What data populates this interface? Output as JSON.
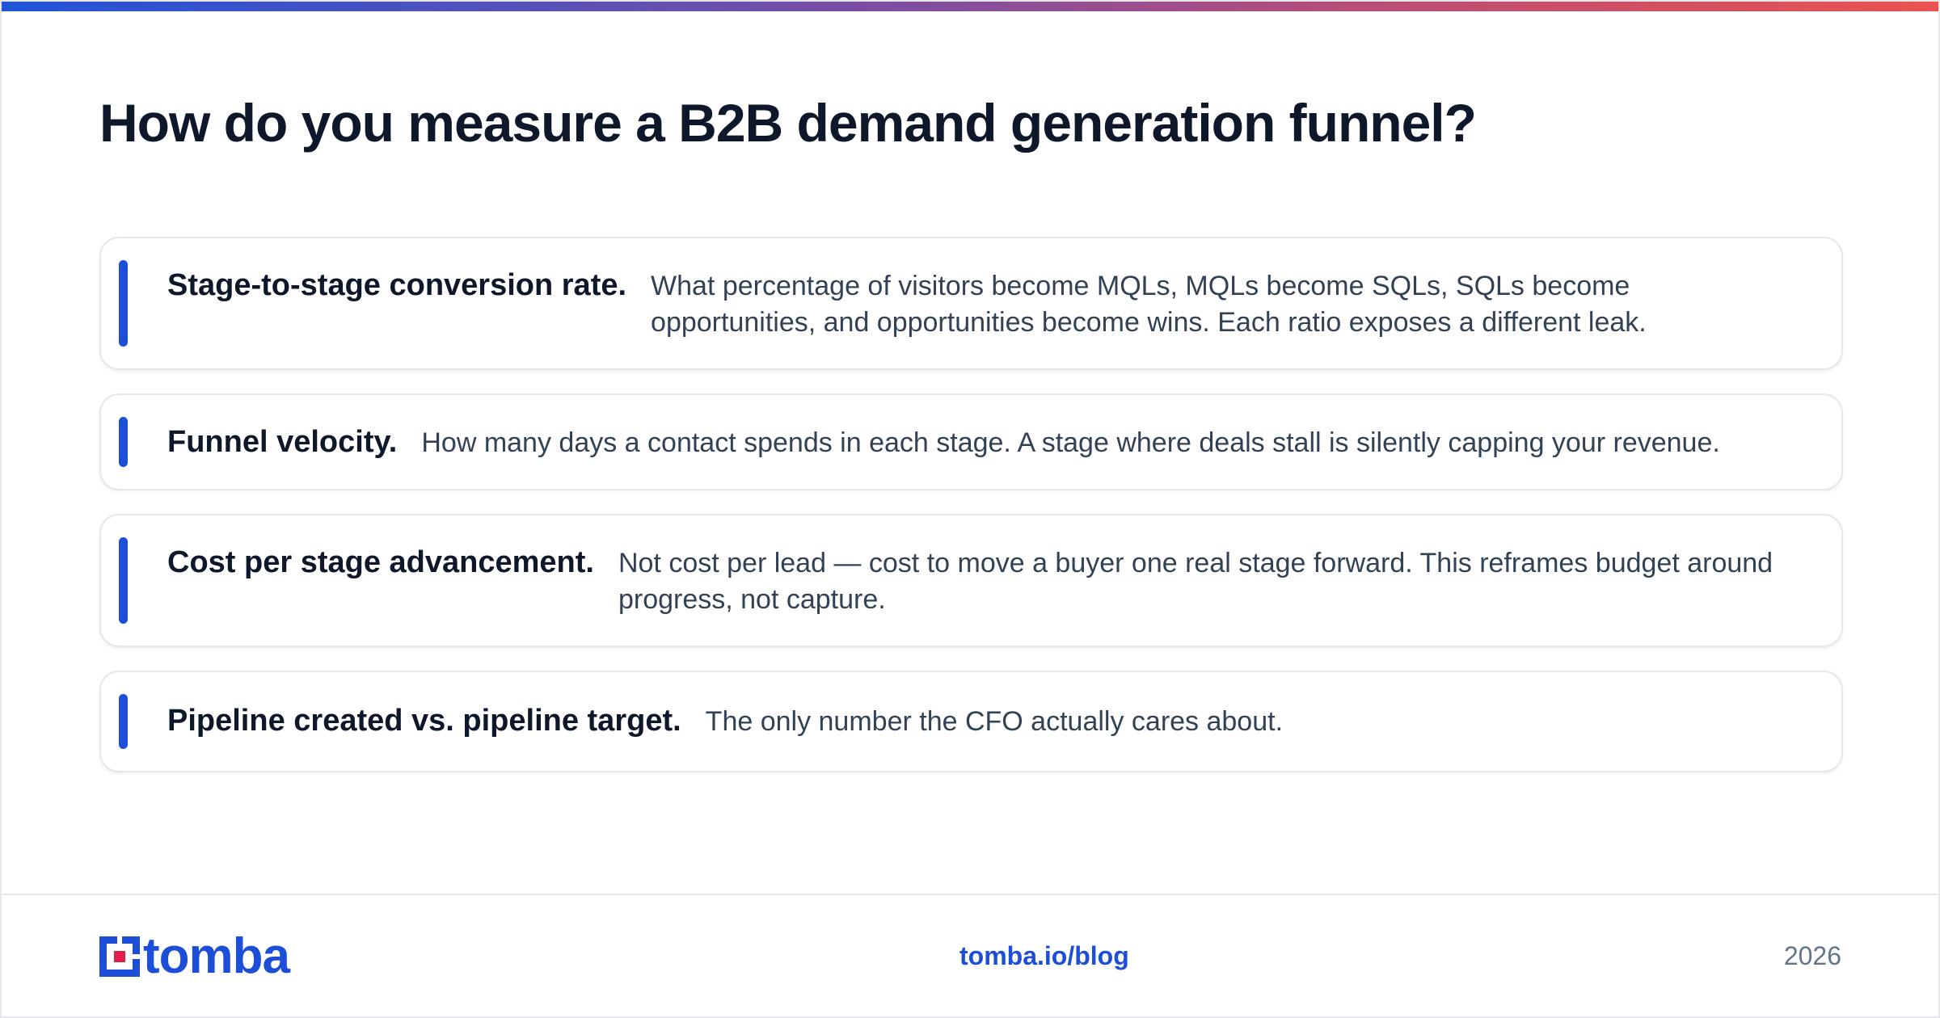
{
  "colors": {
    "accent": "#1d4ed8",
    "title": "#0f172a",
    "body_text": "#334155",
    "muted": "#64748b",
    "gradient_start": "#2154d9",
    "gradient_end": "#e9534f"
  },
  "page": {
    "title": "How do you measure a B2B demand generation funnel?"
  },
  "cards": [
    {
      "label": "Stage-to-stage conversion rate.",
      "description": "What percentage of visitors become MQLs, MQLs become SQLs, SQLs become opportunities, and opportunities become wins. Each ratio exposes a different leak."
    },
    {
      "label": "Funnel velocity.",
      "description": "How many days a contact spends in each stage. A stage where deals stall is silently capping your revenue."
    },
    {
      "label": "Cost per stage advancement.",
      "description": "Not cost per lead — cost to move a buyer one real stage forward. This reframes budget around progress, not capture."
    },
    {
      "label": "Pipeline created vs. pipeline target.",
      "description": "The only number the CFO actually cares about."
    }
  ],
  "footer": {
    "logo_icon": "tomba-logo-icon",
    "logo_text": "tomba",
    "link": "tomba.io/blog",
    "year": "2026"
  }
}
